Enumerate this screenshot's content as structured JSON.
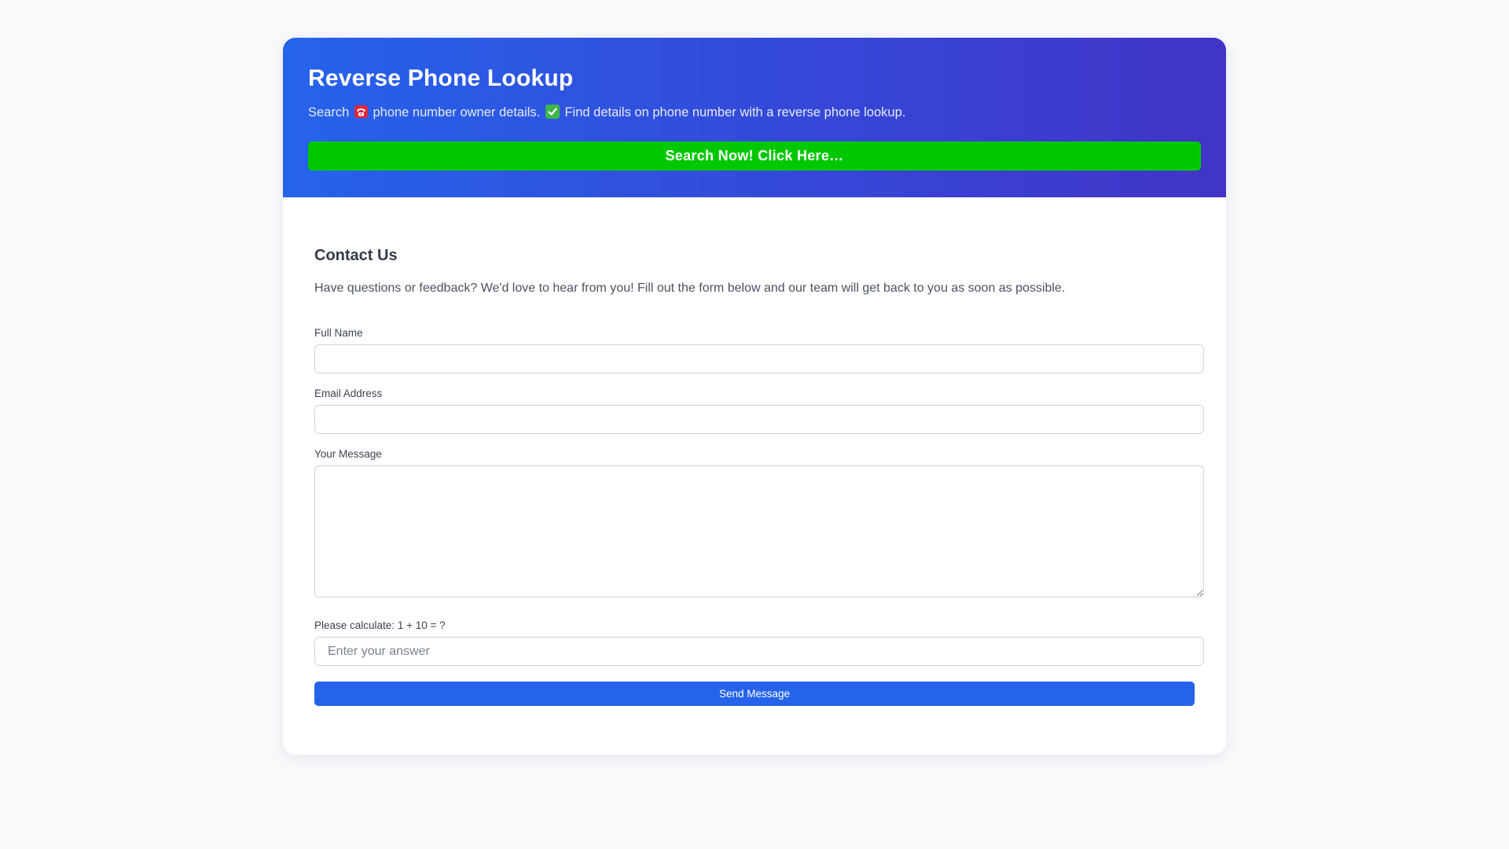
{
  "hero": {
    "title": "Reverse Phone Lookup",
    "subtitle_part1": "Search",
    "subtitle_part2": "phone number owner details.",
    "subtitle_part3": "Find details on phone number with a reverse phone lookup.",
    "cta_label": "Search Now! Click Here…",
    "colors": {
      "gradient_start": "#2563eb",
      "gradient_end": "#4134c7",
      "cta": "#00c800"
    },
    "icons": [
      "telephone-emoji-icon",
      "check-mark-emoji-icon"
    ]
  },
  "contact": {
    "title": "Contact Us",
    "intro": "Have questions or feedback? We'd love to hear from you! Fill out the form below and our team will get back to you as soon as possible."
  },
  "form": {
    "full_name": {
      "label": "Full Name",
      "value": ""
    },
    "email": {
      "label": "Email Address",
      "value": ""
    },
    "message": {
      "label": "Your Message",
      "value": ""
    },
    "captcha": {
      "label": "Please calculate: 1 + 10 = ?",
      "placeholder": "Enter your answer",
      "value": ""
    },
    "submit_label": "Send Message",
    "colors": {
      "submit": "#2563eb"
    }
  }
}
